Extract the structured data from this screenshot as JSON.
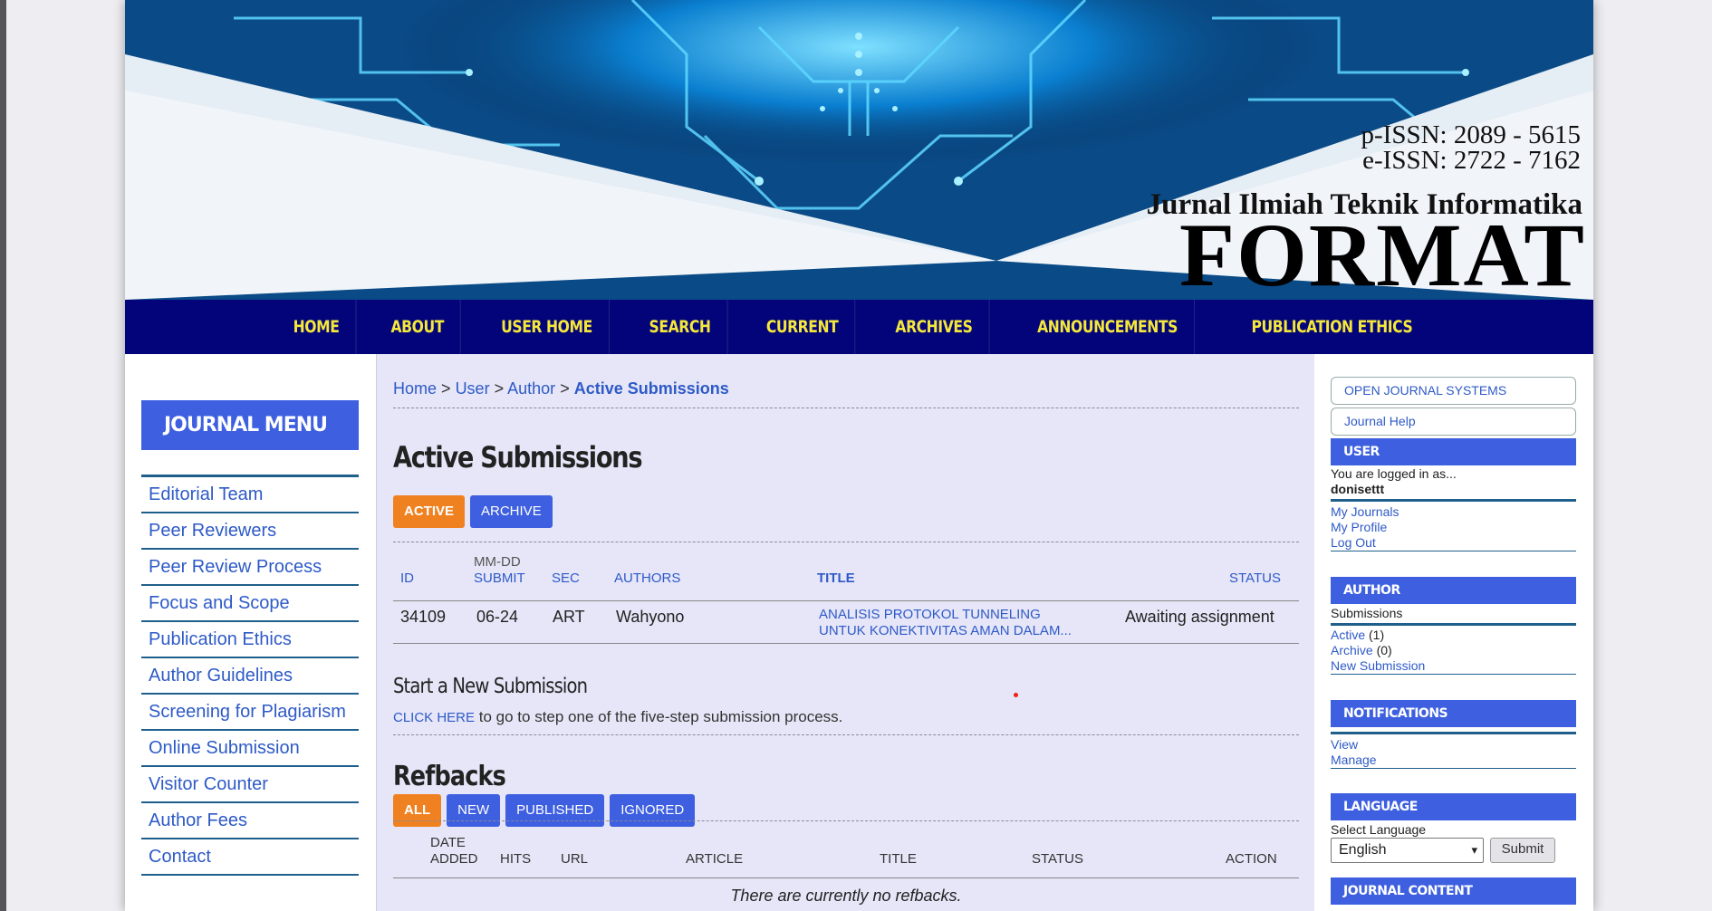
{
  "banner": {
    "pissn": "p-ISSN: 2089 - 5615",
    "eissn": "e-ISSN: 2722 - 7162",
    "journal_name": "Jurnal Ilmiah Teknik Informatika",
    "journal_title": "FORMAT"
  },
  "nav": [
    "HOME",
    "ABOUT",
    "USER HOME",
    "SEARCH",
    "CURRENT",
    "ARCHIVES",
    "ANNOUNCEMENTS",
    "PUBLICATION ETHICS"
  ],
  "left_menu": {
    "heading": "JOURNAL MENU",
    "items": [
      "Editorial Team",
      "Peer Reviewers",
      "Peer Review Process",
      "Focus and Scope",
      "Publication Ethics",
      "Author Guidelines",
      "Screening for Plagiarism",
      "Online Submission",
      "Visitor Counter",
      "Author Fees",
      "Contact"
    ]
  },
  "breadcrumb": {
    "home": "Home",
    "sep": ">",
    "user": "User",
    "author": "Author",
    "current": "Active Submissions"
  },
  "page_title": "Active Submissions",
  "submission_tabs": [
    "ACTIVE",
    "ARCHIVE"
  ],
  "submissions": {
    "headers": {
      "id": "ID",
      "date_top": "MM-DD",
      "date_bottom": "SUBMIT",
      "sec": "SEC",
      "authors": "AUTHORS",
      "title": "TITLE",
      "status": "STATUS"
    },
    "rows": [
      {
        "id": "34109",
        "date": "06-24",
        "sec": "ART",
        "authors": "Wahyono",
        "title_line1": "ANALISIS PROTOKOL TUNNELING",
        "title_line2": "UNTUK KONEKTIVITAS AMAN DALAM...",
        "status": "Awaiting assignment"
      }
    ]
  },
  "new_submission": {
    "heading": "Start a New Submission",
    "link": "CLICK HERE",
    "text": "to go to step one of the five-step submission process."
  },
  "refbacks": {
    "heading": "Refbacks",
    "tabs": [
      "ALL",
      "NEW",
      "PUBLISHED",
      "IGNORED"
    ],
    "headers": {
      "date_top": "DATE",
      "date_bottom": "ADDED",
      "hits": "HITS",
      "url": "URL",
      "article": "ARTICLE",
      "title": "TITLE",
      "status": "STATUS",
      "action": "ACTION"
    },
    "empty": "There are currently no refbacks."
  },
  "sidebar": {
    "ojs": "OPEN JOURNAL SYSTEMS",
    "help": "Journal Help",
    "user": {
      "heading": "USER",
      "logged": "You are logged in as...",
      "username": "donisettt",
      "links": [
        "My Journals",
        "My Profile",
        "Log Out"
      ]
    },
    "author": {
      "heading": "AUTHOR",
      "label": "Submissions",
      "active": "Active",
      "active_count": "(1)",
      "archive": "Archive",
      "archive_count": "(0)",
      "new": "New Submission"
    },
    "notifications": {
      "heading": "NOTIFICATIONS",
      "links": [
        "View",
        "Manage"
      ]
    },
    "language": {
      "heading": "LANGUAGE",
      "label": "Select Language",
      "selected": "English",
      "submit": "Submit"
    },
    "content": {
      "heading": "JOURNAL CONTENT"
    }
  }
}
